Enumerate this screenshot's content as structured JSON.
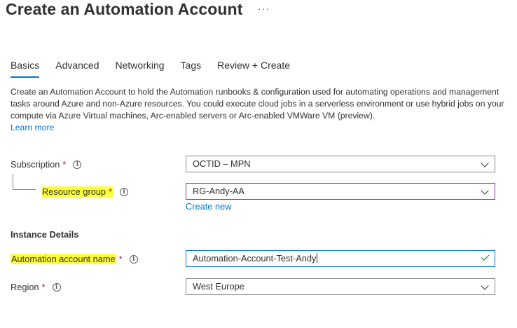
{
  "page": {
    "title": "Create an Automation Account",
    "more_glyph": "···"
  },
  "tabs": [
    {
      "label": "Basics",
      "active": true
    },
    {
      "label": "Advanced",
      "active": false
    },
    {
      "label": "Networking",
      "active": false
    },
    {
      "label": "Tags",
      "active": false
    },
    {
      "label": "Review + Create",
      "active": false
    }
  ],
  "description": {
    "text": "Create an Automation Account to hold the Automation runbooks & configuration used for automating operations and management tasks around Azure and non-Azure resources. You could execute cloud jobs in a serverless environment or use hybrid jobs on your compute via Azure Virtual machines, Arc-enabled servers or Arc-enabled VMWare VM (preview).",
    "learn_more": "Learn more"
  },
  "form": {
    "subscription": {
      "label": "Subscription",
      "required": "*",
      "value": "OCTID – MPN"
    },
    "resource_group": {
      "label": "Resource group",
      "required": "*",
      "value": "RG-Andy-AA",
      "create_new": "Create new"
    },
    "instance_details_heading": "Instance Details",
    "account_name": {
      "label": "Automation account name",
      "required": "*",
      "value": "Automation-Account-Test-Andy"
    },
    "region": {
      "label": "Region",
      "required": "*",
      "value": "West Europe"
    }
  },
  "icons": {
    "info": "info-icon",
    "chevron": "chevron-down-icon",
    "check": "check-icon",
    "info_glyph": "i"
  },
  "colors": {
    "accent": "#0078d4",
    "highlight": "#ffff3a",
    "required": "#a4262c",
    "valid": "#107c10"
  }
}
